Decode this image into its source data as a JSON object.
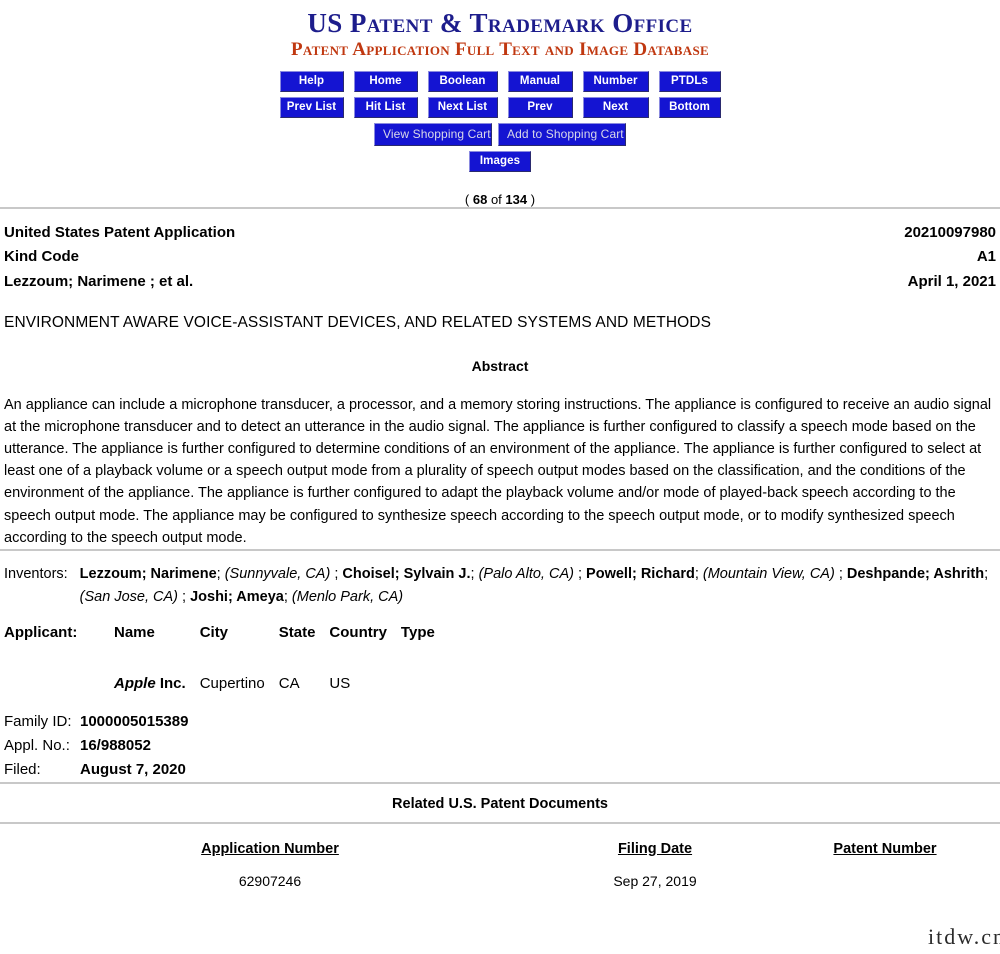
{
  "masthead": {
    "line1": "US Patent & Trademark Office",
    "line2": "Patent Application Full Text and Image Database",
    "line1_color": "#1d1d8c",
    "line2_color": "#c03810"
  },
  "toolbar": {
    "button_color": "#1414d2",
    "row1": [
      {
        "label": "Help"
      },
      {
        "label": "Home"
      },
      {
        "label": "Boolean"
      },
      {
        "label": "Manual"
      },
      {
        "label": "Number"
      },
      {
        "label": "PTDLs"
      }
    ],
    "row2": [
      {
        "label": "Prev List"
      },
      {
        "label": "Hit List"
      },
      {
        "label": "Next List"
      },
      {
        "label": "Prev"
      },
      {
        "label": "Next"
      },
      {
        "label": "Bottom"
      }
    ],
    "row3": [
      {
        "label": "View Shopping Cart"
      },
      {
        "label": "Add to Shopping Cart"
      }
    ],
    "row4": [
      {
        "label": "Images"
      }
    ]
  },
  "record_counter": {
    "open_paren": "(",
    "current": "68",
    "of": "of",
    "total": "134",
    "close_paren": ")"
  },
  "identification": [
    {
      "label": "United States Patent Application",
      "value": "20210097980"
    },
    {
      "label": "Kind Code",
      "value": "A1"
    },
    {
      "label": "Lezzoum; Narimene ;   et al.",
      "value": "April 1, 2021"
    }
  ],
  "document": {
    "title": "ENVIRONMENT AWARE VOICE-ASSISTANT DEVICES, AND RELATED SYSTEMS AND METHODS",
    "abstract_heading": "Abstract",
    "abstract": "An appliance can include a microphone transducer, a processor, and a memory storing instructions. The appliance is configured to receive an audio signal at the microphone transducer and to detect an utterance in the audio signal. The appliance is further configured to classify a speech mode based on the utterance. The appliance is further configured to determine conditions of an environment of the appliance. The appliance is further configured to select at least one of a playback volume or a speech output mode from a plurality of speech output modes based on the classification, and the conditions of the environment of the appliance. The appliance is further configured to adapt the playback volume and/or mode of played-back speech according to the speech output mode. The appliance may be configured to synthesize speech according to the speech output mode, or to modify synthesized speech according to the speech output mode."
  },
  "inventors": {
    "label": "Inventors:",
    "entries": [
      {
        "name": "Lezzoum; Narimene",
        "location": "(Sunnyvale, CA)"
      },
      {
        "name": "Choisel; Sylvain J.",
        "location": "(Palo Alto, CA)"
      },
      {
        "name": "Powell; Richard",
        "location": "(Mountain View, CA)"
      },
      {
        "name": "Deshpande; Ashrith",
        "location": "(San Jose, CA)"
      },
      {
        "name": "Joshi; Ameya",
        "location": "(Menlo Park, CA)"
      }
    ]
  },
  "applicant": {
    "label": "Applicant:",
    "headers": [
      "Name",
      "City",
      "State",
      "Country",
      "Type"
    ],
    "rows": [
      {
        "name_italic": "Apple",
        "name_rest": " Inc.",
        "city": "Cupertino",
        "state": "CA",
        "country": "US",
        "type": ""
      }
    ]
  },
  "meta": [
    {
      "label": "Family ID:",
      "value": "1000005015389"
    },
    {
      "label": "Appl. No.:",
      "value": "16/988052"
    },
    {
      "label": "Filed:",
      "value": "August 7, 2020"
    }
  ],
  "related": {
    "heading": "Related U.S. Patent Documents",
    "headers": [
      "Application Number",
      "Filing Date",
      "Patent Number"
    ],
    "rows": [
      {
        "application_number": "62907246",
        "filing_date": "Sep 27, 2019",
        "patent_number": ""
      }
    ]
  },
  "watermark": {
    "text": "itdw.cn"
  }
}
